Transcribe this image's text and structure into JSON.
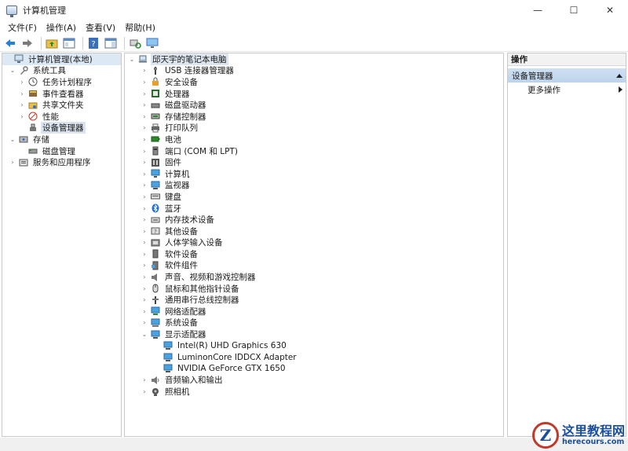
{
  "window": {
    "title": "计算机管理",
    "minimize": "—",
    "maximize": "☐",
    "close": "✕"
  },
  "menu": [
    "文件(F)",
    "操作(A)",
    "查看(V)",
    "帮助(H)"
  ],
  "left_tree": {
    "root": "计算机管理(本地)",
    "system_tools": "系统工具",
    "task_scheduler": "任务计划程序",
    "event_viewer": "事件查看器",
    "shared_folders": "共享文件夹",
    "performance": "性能",
    "device_manager": "设备管理器",
    "storage": "存储",
    "disk_management": "磁盘管理",
    "services_apps": "服务和应用程序"
  },
  "device_tree": {
    "computer": "邱天宇的笔记本电脑",
    "categories": [
      "USB 连接器管理器",
      "安全设备",
      "处理器",
      "磁盘驱动器",
      "存储控制器",
      "打印队列",
      "电池",
      "端口 (COM 和 LPT)",
      "固件",
      "计算机",
      "监视器",
      "键盘",
      "蓝牙",
      "内存技术设备",
      "其他设备",
      "人体学输入设备",
      "软件设备",
      "软件组件",
      "声音、视频和游戏控制器",
      "鼠标和其他指针设备",
      "通用串行总线控制器",
      "网络适配器",
      "系统设备",
      "显示适配器"
    ],
    "display_adapters": [
      "Intel(R) UHD Graphics 630",
      "LuminonCore IDDCX Adapter",
      "NVIDIA GeForce GTX 1650"
    ],
    "after": [
      "音频输入和输出",
      "照相机"
    ]
  },
  "actions": {
    "title": "操作",
    "section": "设备管理器",
    "more": "更多操作"
  },
  "watermark": {
    "logo": "Z",
    "title": "这里教程网",
    "url": "herecours.com"
  }
}
